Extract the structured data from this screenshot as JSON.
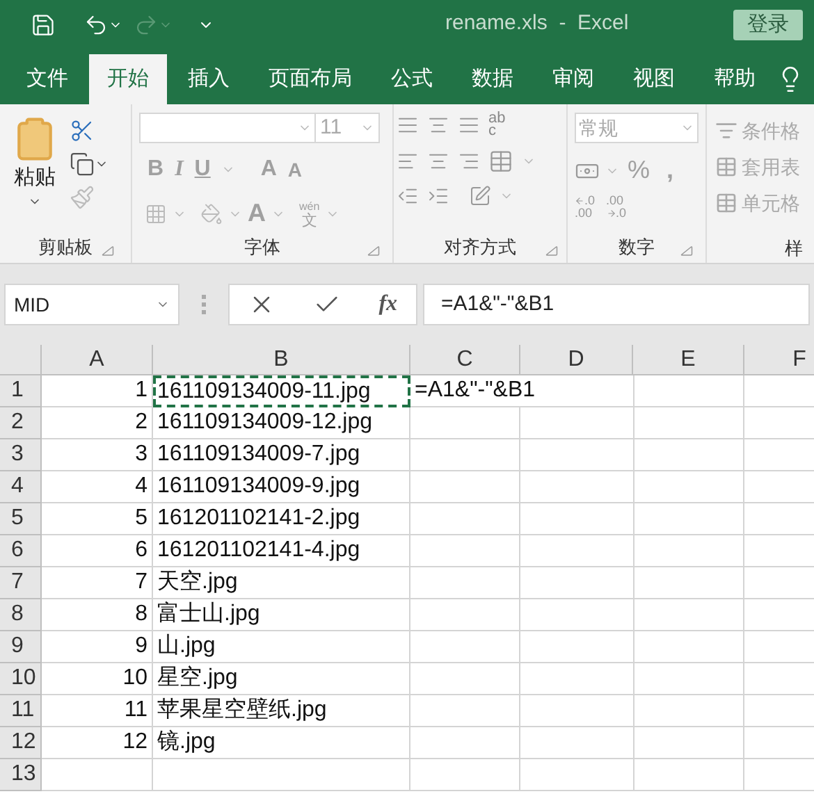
{
  "title_bar": {
    "title": "rename.xls  -  Excel",
    "login_button": "登录"
  },
  "tabs": [
    {
      "label": "文件",
      "selected": false
    },
    {
      "label": "开始",
      "selected": true
    },
    {
      "label": "插入",
      "selected": false
    },
    {
      "label": "页面布局",
      "selected": false
    },
    {
      "label": "公式",
      "selected": false
    },
    {
      "label": "数据",
      "selected": false
    },
    {
      "label": "审阅",
      "selected": false
    },
    {
      "label": "视图",
      "selected": false
    },
    {
      "label": "帮助",
      "selected": false
    }
  ],
  "ribbon": {
    "clipboard": {
      "paste": "粘贴",
      "label": "剪贴板"
    },
    "font": {
      "font_size": "11",
      "bold": "B",
      "italic": "I",
      "underline": "U",
      "grow": "A",
      "shrink": "A",
      "font_color": "A",
      "phonetic_top": "wén",
      "phonetic_bottom": "文",
      "label": "字体"
    },
    "alignment": {
      "wrap_top": "ab",
      "wrap_bottom": "c",
      "label": "对齐方式"
    },
    "number": {
      "format": "常规",
      "percent": "%",
      "comma": ",",
      "increase": [
        ".0",
        ".00"
      ],
      "decrease": [
        ".00",
        ".0"
      ],
      "label": "数字"
    },
    "styles": {
      "items": [
        "条件格",
        "套用表",
        "单元格"
      ],
      "label": "样"
    }
  },
  "formula_bar": {
    "name_box": "MID",
    "fx": "fx",
    "formula": "=A1&\"-\"&B1"
  },
  "sheet": {
    "columns": [
      "A",
      "B",
      "C",
      "D",
      "E",
      "F"
    ],
    "rows": [
      {
        "number": "1",
        "a": "1",
        "b": "161109134009-11.jpg",
        "c": "=A1&\"-\"&B1",
        "marquee": true
      },
      {
        "number": "2",
        "a": "2",
        "b": "161109134009-12.jpg",
        "marquee": false
      },
      {
        "number": "3",
        "a": "3",
        "b": "161109134009-7.jpg",
        "marquee": false
      },
      {
        "number": "4",
        "a": "4",
        "b": "161109134009-9.jpg",
        "marquee": false
      },
      {
        "number": "5",
        "a": "5",
        "b": "161201102141-2.jpg",
        "marquee": false
      },
      {
        "number": "6",
        "a": "6",
        "b": "161201102141-4.jpg",
        "marquee": false
      },
      {
        "number": "7",
        "a": "7",
        "b": "天空.jpg",
        "marquee": false
      },
      {
        "number": "8",
        "a": "8",
        "b": "富士山.jpg",
        "marquee": false
      },
      {
        "number": "9",
        "a": "9",
        "b": "山.jpg",
        "marquee": false
      },
      {
        "number": "10",
        "a": "10",
        "b": "星空.jpg",
        "marquee": false
      },
      {
        "number": "11",
        "a": "11",
        "b": "苹果星空壁纸.jpg",
        "marquee": false
      },
      {
        "number": "12",
        "a": "12",
        "b": "镜.jpg",
        "marquee": false
      },
      {
        "number": "13",
        "marquee": false
      }
    ]
  }
}
